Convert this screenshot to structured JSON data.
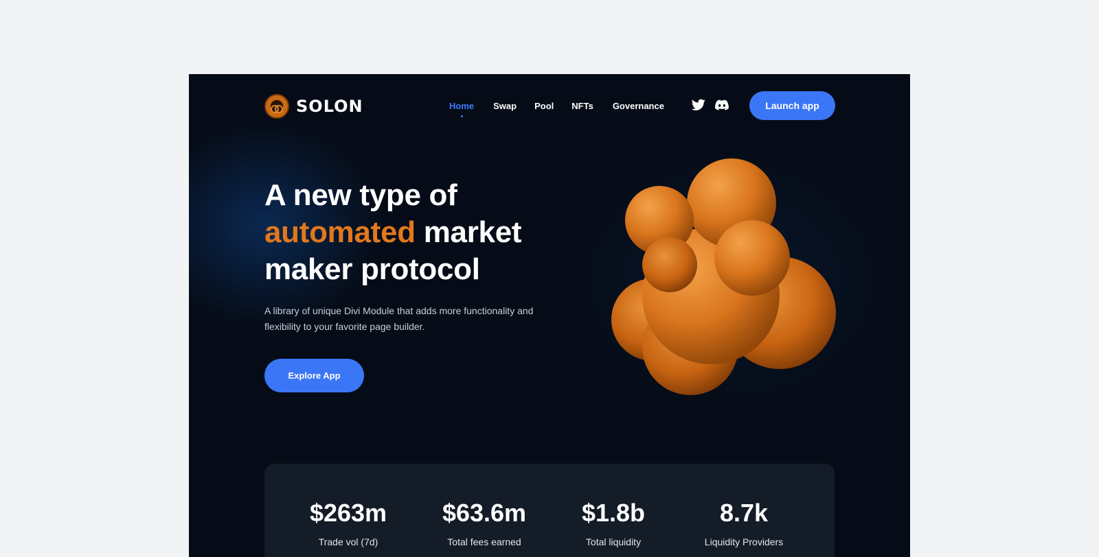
{
  "brand": {
    "name": "SOLON"
  },
  "nav": {
    "items": [
      {
        "label": "Home",
        "active": true
      },
      {
        "label": "Swap",
        "active": false
      },
      {
        "label": "Pool",
        "active": false
      },
      {
        "label": "NFTs",
        "active": false
      },
      {
        "label": "Governance",
        "active": false
      }
    ]
  },
  "social": {
    "icons": [
      "twitter-icon",
      "discord-icon"
    ]
  },
  "header": {
    "launch_label": "Launch app"
  },
  "hero": {
    "title_line1": "A new type of",
    "title_accent": "automated",
    "title_line2_rest": " market",
    "title_line3": "maker protocol",
    "subtitle": "A library of unique Divi Module that adds more functionality and flexibility to your favorite page builder.",
    "cta_label": "Explore App"
  },
  "stats": [
    {
      "value": "$263m",
      "label": "Trade vol (7d)"
    },
    {
      "value": "$63.6m",
      "label": "Total fees earned"
    },
    {
      "value": "$1.8b",
      "label": "Total liquidity"
    },
    {
      "value": "8.7k",
      "label": "Liquidity Providers"
    }
  ],
  "colors": {
    "page_bg": "#f2f3f5",
    "hero_bg": "#060c17",
    "accent_orange": "#e0781d",
    "primary_blue": "#3b76f6",
    "stats_bg": "#141c28"
  }
}
